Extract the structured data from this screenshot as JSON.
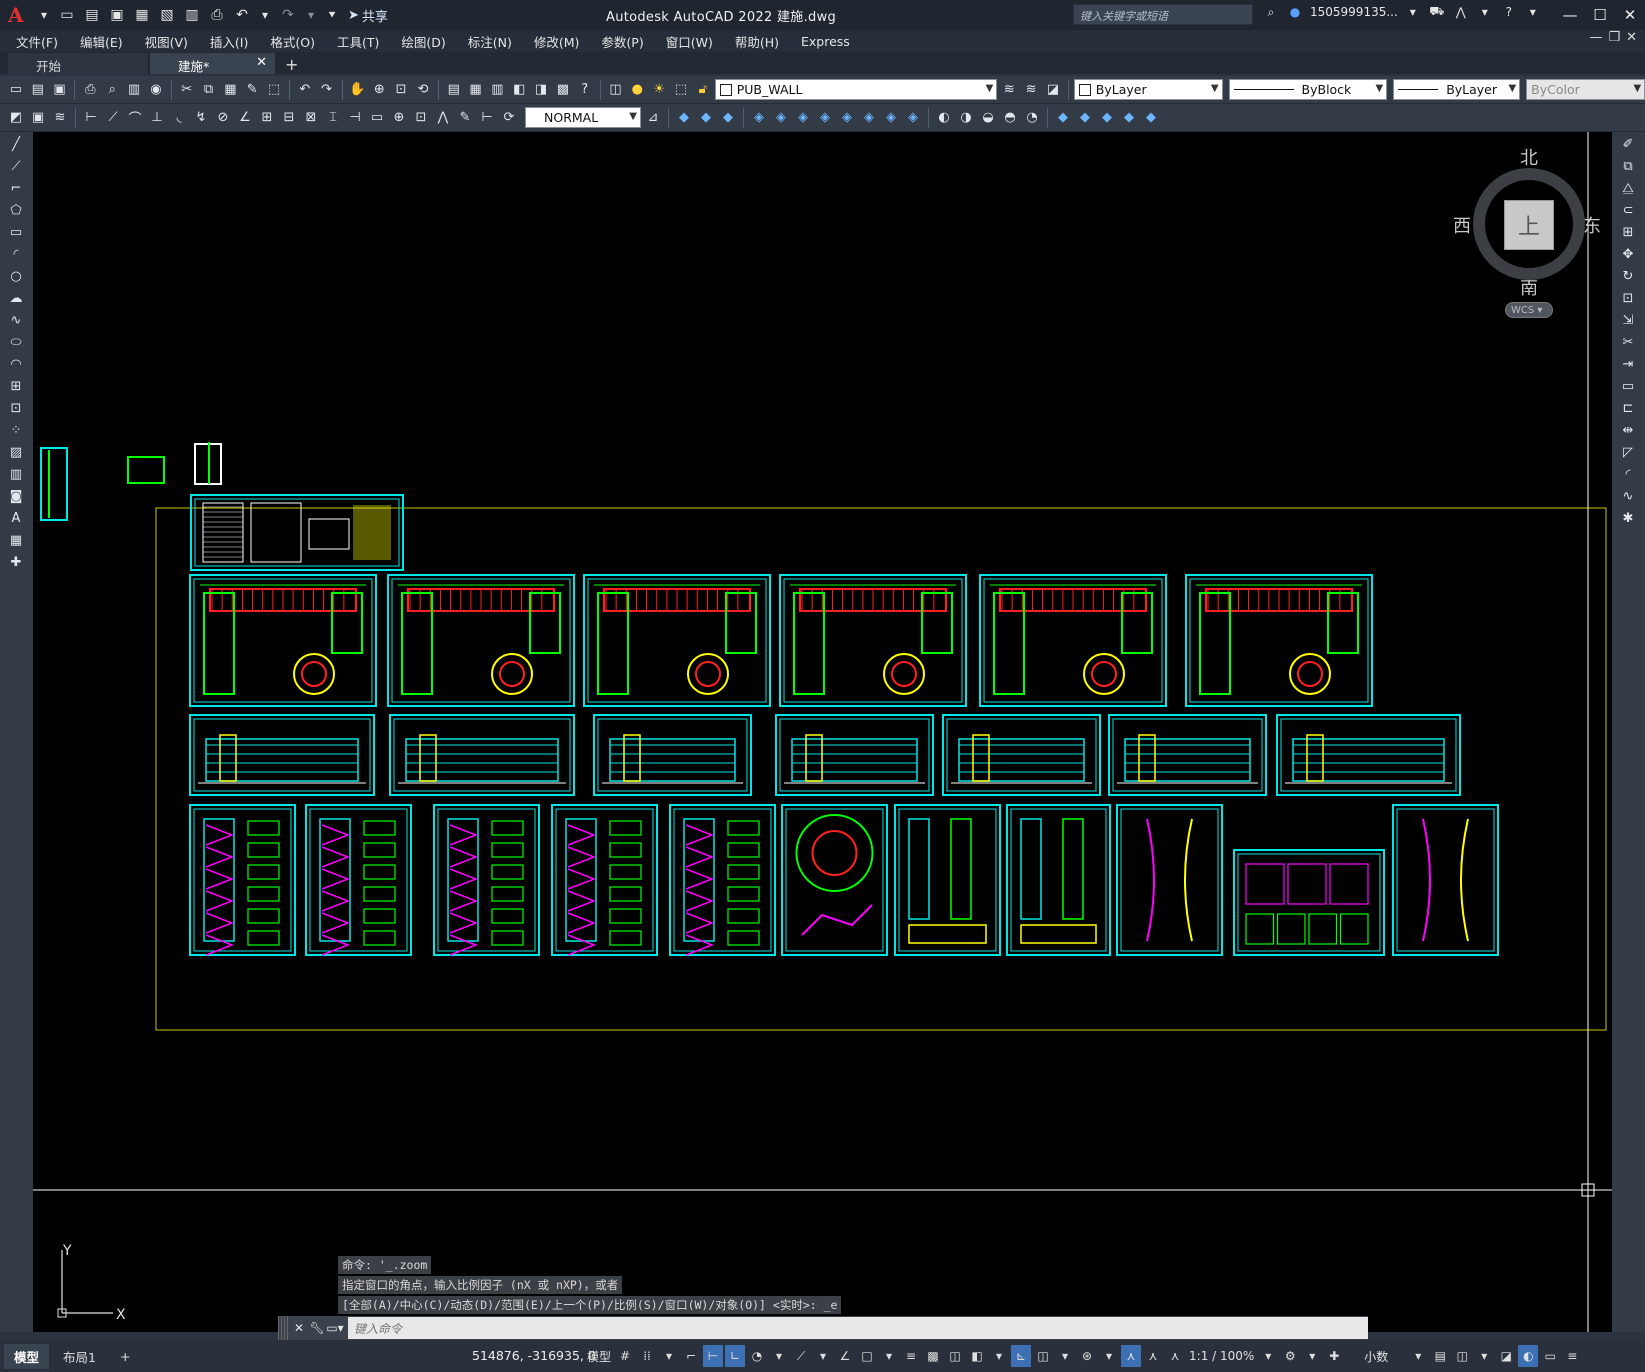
{
  "titlebar": {
    "logo": "A",
    "share_label": "共享",
    "title": "Autodesk AutoCAD 2022    建施.dwg",
    "search_placeholder": "键入关键字或短语",
    "user": "1505999135...",
    "minimize": "—",
    "maximize": "☐",
    "close": "✕"
  },
  "menubar": {
    "items": [
      "文件(F)",
      "编辑(E)",
      "视图(V)",
      "插入(I)",
      "格式(O)",
      "工具(T)",
      "绘图(D)",
      "标注(N)",
      "修改(M)",
      "参数(P)",
      "窗口(W)",
      "帮助(H)",
      "Express"
    ]
  },
  "filetabs": {
    "tabs": [
      {
        "label": "开始",
        "active": false
      },
      {
        "label": "建施*",
        "active": true
      }
    ],
    "add": "+"
  },
  "toolbar1": {
    "layer": "PUB_WALL",
    "color": "ByLayer",
    "linetype": "ByBlock",
    "lineweight": "ByLayer",
    "plotstyle": "ByColor"
  },
  "toolbar2": {
    "dimstyle": "NORMAL"
  },
  "viewcube": {
    "north": "北",
    "south": "南",
    "east": "东",
    "west": "西",
    "top": "上",
    "wcs": "WCS"
  },
  "command": {
    "history": [
      "命令: '_.zoom",
      "指定窗口的角点，输入比例因子 (nX 或 nXP)，或者",
      "[全部(A)/中心(C)/动态(D)/范围(E)/上一个(P)/比例(S)/窗口(W)/对象(O)] <实时>: _e"
    ],
    "placeholder": "键入命令"
  },
  "ucs": {
    "x": "X",
    "y": "Y"
  },
  "statusbar": {
    "layout_tabs": [
      "模型",
      "布局1"
    ],
    "add": "+",
    "coords": "514876, -316935, 0",
    "model": "模型",
    "scale": "1:1 / 100%",
    "units": "小数"
  },
  "colors": {
    "frame": "#00e5e5",
    "extent": "#c8c800",
    "plan_green": "#00ff00",
    "plan_red": "#ff2020",
    "magenta": "#ff00ff",
    "yellow": "#ffff00"
  }
}
